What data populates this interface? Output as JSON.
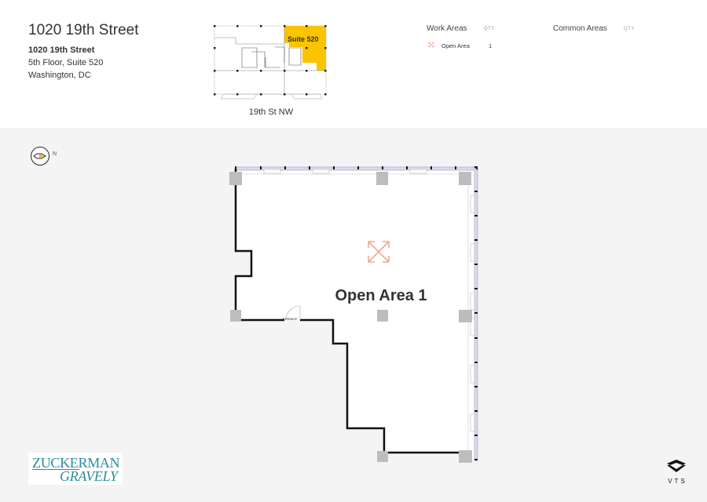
{
  "header": {
    "title": "1020 19th Street",
    "address_line1": "1020 19th Street",
    "address_line2": "5th Floor, Suite 520",
    "address_line3": "Washington, DC"
  },
  "keyplan": {
    "suite_label": "Suite 520",
    "street_label": "19th St NW",
    "highlight_color": "#fbc400"
  },
  "legend": {
    "work_areas": {
      "heading": "Work Areas",
      "qty_label": "QTY",
      "items": [
        {
          "icon": "expand-arrows-icon",
          "label": "Open Area",
          "qty": "1",
          "color": "#f2a98a"
        }
      ]
    },
    "common_areas": {
      "heading": "Common Areas",
      "qty_label": "QTY",
      "items": []
    }
  },
  "plan": {
    "compass_label": "N",
    "room_label": "Open Area 1",
    "room_icon": "expand-arrows-icon",
    "entrance_label": "Entrance"
  },
  "branding": {
    "broker_line1": "ZUCKERMAN",
    "broker_line2": "GRAVELY",
    "platform": "VTS"
  }
}
